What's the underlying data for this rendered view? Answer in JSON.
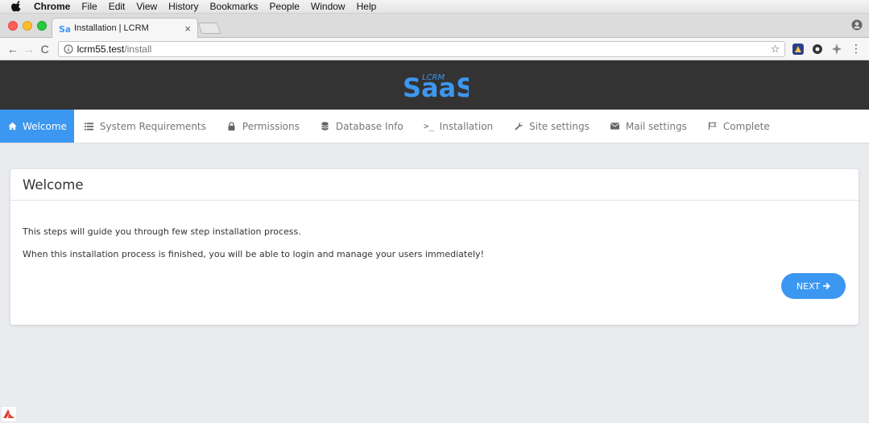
{
  "menubar": {
    "items": [
      "Chrome",
      "File",
      "Edit",
      "View",
      "History",
      "Bookmarks",
      "People",
      "Window",
      "Help"
    ]
  },
  "browser": {
    "tab_title": "Installation | LCRM",
    "tab_close": "×",
    "url_host": "lcrm55.test",
    "url_path": "/install"
  },
  "nav": {
    "items": [
      {
        "label": "Welcome",
        "icon": "home-icon",
        "active": true
      },
      {
        "label": "System Requirements",
        "icon": "list-icon"
      },
      {
        "label": "Permissions",
        "icon": "lock-icon"
      },
      {
        "label": "Database Info",
        "icon": "database-icon"
      },
      {
        "label": "Installation",
        "icon": "terminal-icon"
      },
      {
        "label": "Site settings",
        "icon": "wrench-icon"
      },
      {
        "label": "Mail settings",
        "icon": "envelope-icon"
      },
      {
        "label": "Complete",
        "icon": "flag-icon"
      }
    ]
  },
  "card": {
    "title": "Welcome",
    "line1": "This steps will guide you through few step installation process.",
    "line2": "When this installation process is finished, you will be able to login and manage your users immediately!",
    "next_label": "NEXT"
  },
  "logo": {
    "text": "SaaS",
    "small_text": "LCRM"
  },
  "colors": {
    "accent": "#3c97f0",
    "header_bg": "#333333",
    "page_bg": "#e9ebee"
  }
}
